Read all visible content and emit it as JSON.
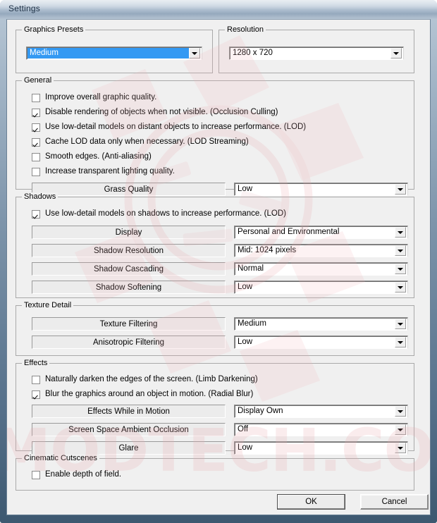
{
  "window": {
    "title": "Settings"
  },
  "groups": {
    "graphics_presets": {
      "title": "Graphics Presets",
      "preset": {
        "label": "preset-combo",
        "value": "Medium",
        "selected": true
      }
    },
    "resolution": {
      "title": "Resolution",
      "resolution": {
        "value": "1280 x 720",
        "selected": false
      }
    },
    "general": {
      "title": "General",
      "checkboxes": [
        {
          "label": "Improve overall graphic quality.",
          "checked": false
        },
        {
          "label": "Disable rendering of objects when not visible. (Occlusion Culling)",
          "checked": true
        },
        {
          "label": "Use low-detail models on distant objects to increase performance. (LOD)",
          "checked": true
        },
        {
          "label": "Cache LOD data only when necessary. (LOD Streaming)",
          "checked": true
        },
        {
          "label": "Smooth edges. (Anti-aliasing)",
          "checked": false
        },
        {
          "label": "Increase transparent lighting quality.",
          "checked": false
        }
      ],
      "options": [
        {
          "label": "Grass Quality",
          "value": "Low"
        }
      ]
    },
    "shadows": {
      "title": "Shadows",
      "checkboxes": [
        {
          "label": "Use low-detail models on shadows to increase performance. (LOD)",
          "checked": true
        }
      ],
      "options": [
        {
          "label": "Display",
          "value": "Personal and Environmental"
        },
        {
          "label": "Shadow Resolution",
          "value": "Mid: 1024 pixels"
        },
        {
          "label": "Shadow Cascading",
          "value": "Normal"
        },
        {
          "label": "Shadow Softening",
          "value": "Low"
        }
      ]
    },
    "texture_detail": {
      "title": "Texture Detail",
      "options": [
        {
          "label": "Texture Filtering",
          "value": "Medium"
        },
        {
          "label": "Anisotropic Filtering",
          "value": "Low"
        }
      ]
    },
    "effects": {
      "title": "Effects",
      "checkboxes": [
        {
          "label": "Naturally darken the edges of the screen. (Limb Darkening)",
          "checked": false
        },
        {
          "label": "Blur the graphics around an object in motion. (Radial Blur)",
          "checked": true
        }
      ],
      "options": [
        {
          "label": "Effects While in Motion",
          "value": "Display Own"
        },
        {
          "label": "Screen Space Ambient Occlusion",
          "value": "Off"
        },
        {
          "label": "Glare",
          "value": "Low"
        }
      ]
    },
    "cinematic_cutscenes": {
      "title": "Cinematic Cutscenes",
      "checkboxes": [
        {
          "label": "Enable depth of field.",
          "checked": false
        }
      ]
    }
  },
  "buttons": {
    "ok": "OK",
    "cancel": "Cancel"
  },
  "watermark": {
    "text": "VMODTECH.COM",
    "color": "#f0b9bd"
  },
  "colors": {
    "selection_blue": "#3399f3",
    "dialog_bg": "#f0f0f0",
    "group_border": "#a9a9a9",
    "title_text": "#1b2e44"
  }
}
